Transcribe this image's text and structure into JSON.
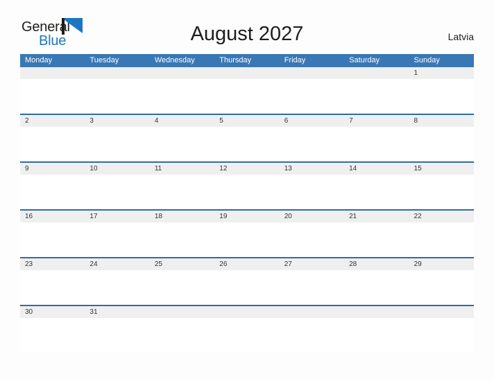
{
  "brand": {
    "name_part1": "General",
    "name_part2": "Blue",
    "flag_icon": "blue-triangle-flag-icon",
    "accent_color": "#1c77c3"
  },
  "header": {
    "title": "August 2027",
    "country": "Latvia"
  },
  "colors": {
    "header_blue": "#3a78b5",
    "divider_blue": "#2e6da4",
    "date_band_gray": "#efefef",
    "page_background": "#fdfdfd",
    "text_dark": "#1d1d1b"
  },
  "calendar": {
    "month": "August",
    "year": "2027",
    "weekday_headers": [
      "Monday",
      "Tuesday",
      "Wednesday",
      "Thursday",
      "Friday",
      "Saturday",
      "Sunday"
    ],
    "weeks": [
      [
        "",
        "",
        "",
        "",
        "",
        "",
        "1"
      ],
      [
        "2",
        "3",
        "4",
        "5",
        "6",
        "7",
        "8"
      ],
      [
        "9",
        "10",
        "11",
        "12",
        "13",
        "14",
        "15"
      ],
      [
        "16",
        "17",
        "18",
        "19",
        "20",
        "21",
        "22"
      ],
      [
        "23",
        "24",
        "25",
        "26",
        "27",
        "28",
        "29"
      ],
      [
        "30",
        "31",
        "",
        "",
        "",
        "",
        ""
      ]
    ]
  }
}
